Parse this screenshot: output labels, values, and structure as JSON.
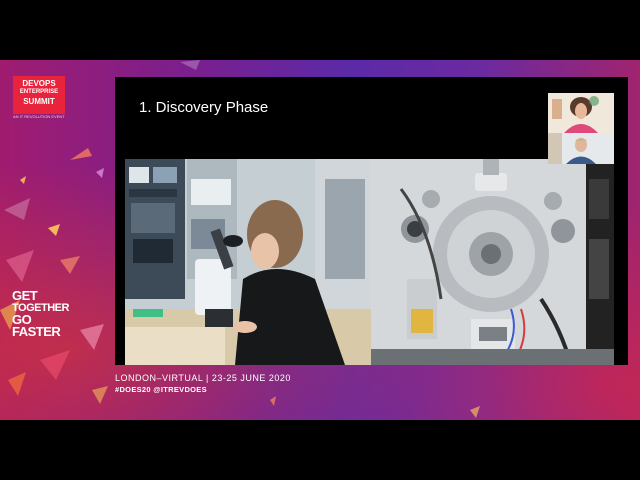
{
  "brand": {
    "logo_line1": "DEVOPS",
    "logo_line2": "ENTERPRISE",
    "logo_line3": "SUMMIT",
    "logo_sub": "AN IT REVOLUTION EVENT",
    "tagline": [
      "GET",
      "TOGETHER",
      "GO",
      "FASTER"
    ]
  },
  "slide": {
    "title": "1. Discovery Phase"
  },
  "footer": {
    "event": "LONDON–VIRTUAL | 23-25 JUNE 2020",
    "tags": "#DOES20 @ITREVDOES"
  },
  "colors": {
    "logo_red": "#e8243c",
    "stage_purple": "#6b2aa0",
    "stage_magenta": "#a01c6f"
  }
}
